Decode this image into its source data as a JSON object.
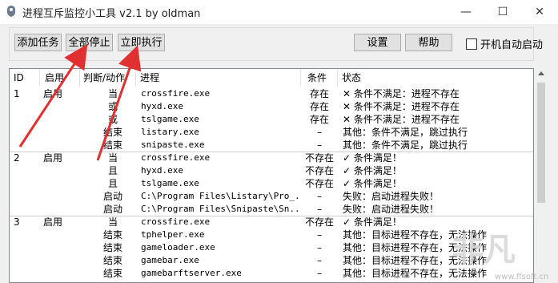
{
  "window": {
    "title": "进程互斥监控小工具 v2.1 by oldman",
    "minimize_glyph": "—",
    "maximize_glyph": "☐",
    "close_glyph": "✕"
  },
  "toolbar": {
    "add_task": "添加任务",
    "stop_all": "全部停止",
    "run_now": "立即执行",
    "settings": "设置",
    "help": "帮助",
    "autostart_label": "开机自动启动",
    "autostart_checked": false
  },
  "table": {
    "columns": [
      "ID",
      "启用",
      "判断/动作",
      "进程",
      "条件",
      "状态"
    ],
    "rows": [
      {
        "id": "1",
        "enabled": "启用",
        "action": "当",
        "process": "crossfire.exe",
        "condition": "存在",
        "status": "✕ 条件不满足：进程不存在"
      },
      {
        "id": "",
        "enabled": "",
        "action": "或",
        "process": "hyxd.exe",
        "condition": "存在",
        "status": "✕ 条件不满足：进程不存在"
      },
      {
        "id": "",
        "enabled": "",
        "action": "或",
        "process": "tslgame.exe",
        "condition": "存在",
        "status": "✕ 条件不满足：进程不存在"
      },
      {
        "id": "",
        "enabled": "",
        "action": "结束",
        "process": "listary.exe",
        "condition": "–",
        "status": "其他：条件不满足，跳过执行"
      },
      {
        "id": "",
        "enabled": "",
        "action": "结束",
        "process": "snipaste.exe",
        "condition": "–",
        "status": "其他：条件不满足，跳过执行"
      },
      {
        "id": "2",
        "enabled": "启用",
        "action": "当",
        "process": "crossfire.exe",
        "condition": "不存在",
        "status": "✓ 条件满足！"
      },
      {
        "id": "",
        "enabled": "",
        "action": "且",
        "process": "hyxd.exe",
        "condition": "不存在",
        "status": "✓ 条件满足！"
      },
      {
        "id": "",
        "enabled": "",
        "action": "且",
        "process": "tslgame.exe",
        "condition": "不存在",
        "status": "✓ 条件满足！"
      },
      {
        "id": "",
        "enabled": "",
        "action": "启动",
        "process": "C:\\Program Files\\Listary\\Pro_...",
        "condition": "–",
        "status": "失败：启动进程失败！"
      },
      {
        "id": "",
        "enabled": "",
        "action": "启动",
        "process": "C:\\Program Files\\Snipaste\\Sn...",
        "condition": "–",
        "status": "失败：启动进程失败！"
      },
      {
        "id": "3",
        "enabled": "启用",
        "action": "当",
        "process": "crossfire.exe",
        "condition": "不存在",
        "status": "✓ 条件满足！"
      },
      {
        "id": "",
        "enabled": "",
        "action": "结束",
        "process": "tphelper.exe",
        "condition": "–",
        "status": "其他：目标进程不存在，无法操作"
      },
      {
        "id": "",
        "enabled": "",
        "action": "结束",
        "process": "gameloader.exe",
        "condition": "–",
        "status": "其他：目标进程不存在，无法操作"
      },
      {
        "id": "",
        "enabled": "",
        "action": "结束",
        "process": "gamebar.exe",
        "condition": "–",
        "status": "其他：目标进程不存在，无法操作"
      },
      {
        "id": "",
        "enabled": "",
        "action": "结束",
        "process": "gamebarftserver.exe",
        "condition": "–",
        "status": "其他：目标进程不存在，无法操作"
      }
    ]
  },
  "watermark": {
    "logo_text": "非凡软件",
    "site": "www.ffsoft.cn"
  },
  "colors": {
    "accent": "#0078d7",
    "annotation_arrow": "#e03030",
    "separator": "#cfcfcf"
  }
}
